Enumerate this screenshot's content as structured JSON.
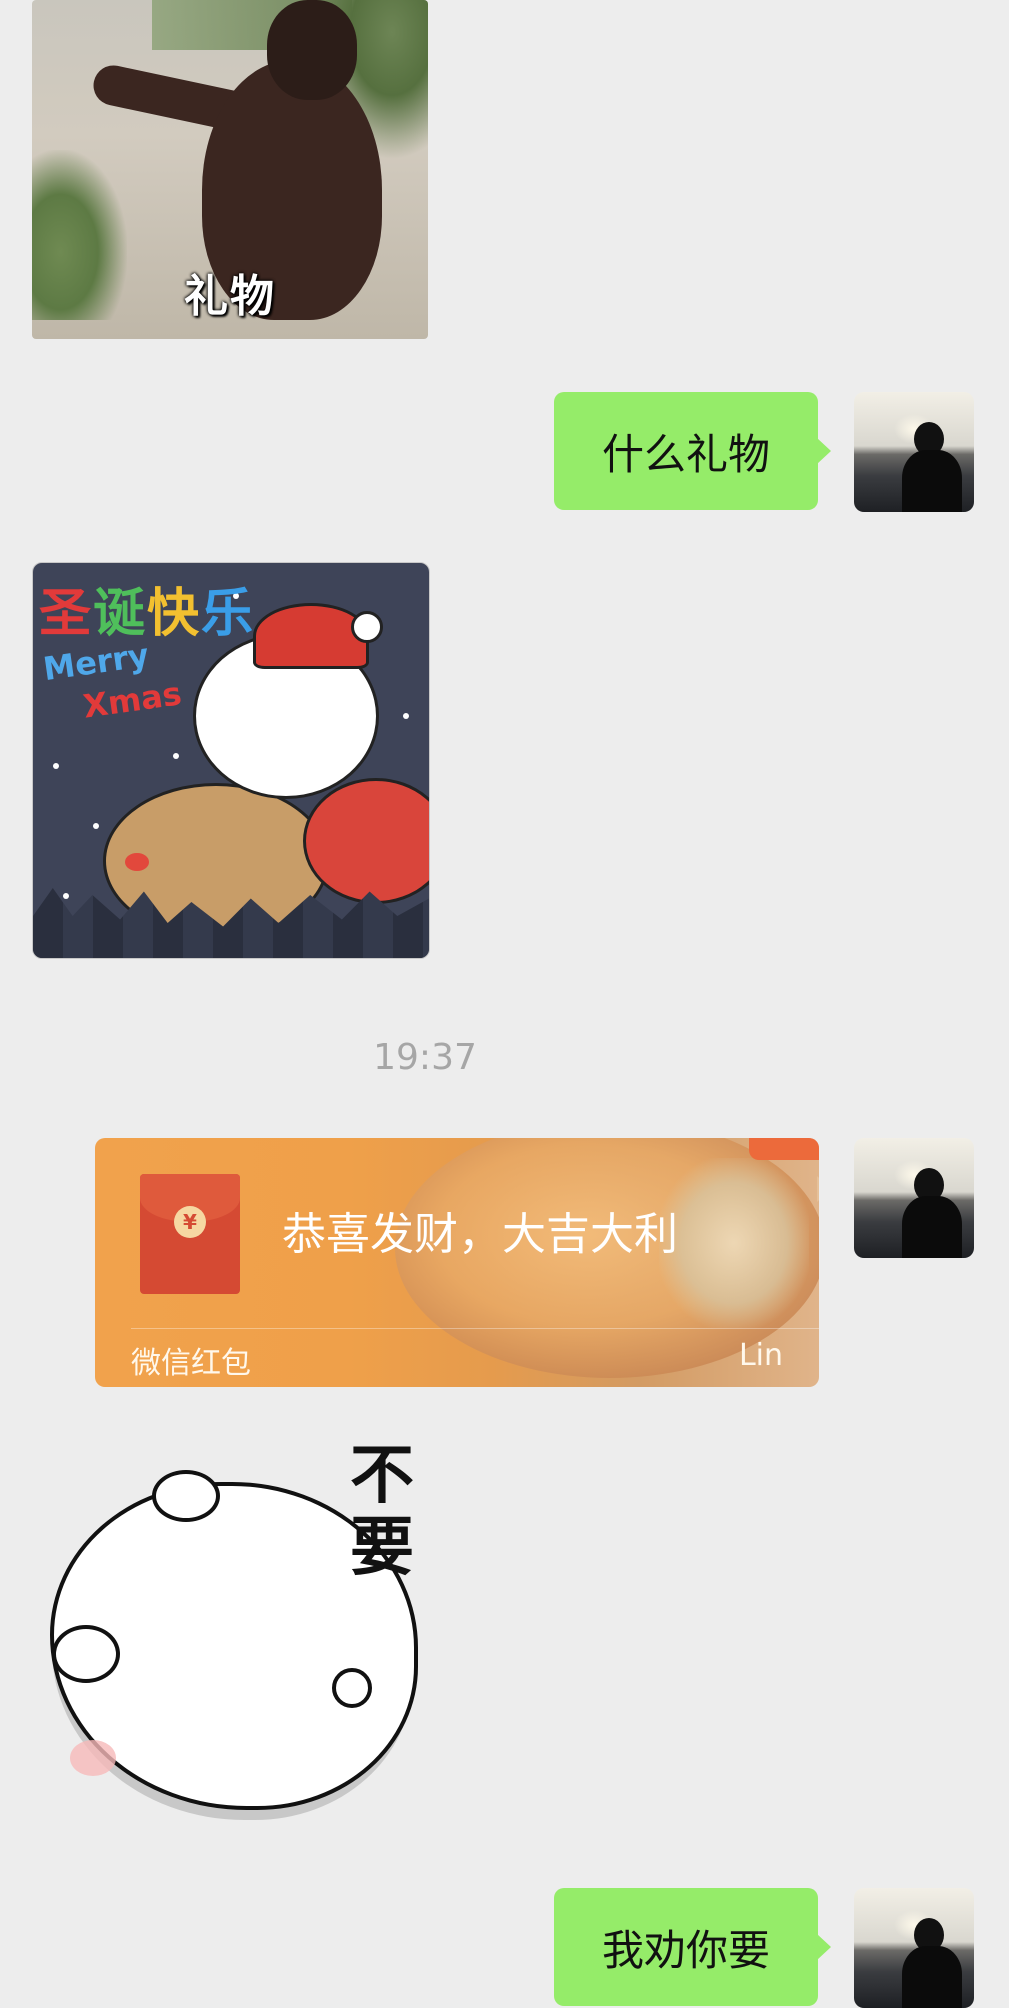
{
  "messages": {
    "sticker_orangutan": {
      "caption": "礼物"
    },
    "out_1": {
      "text": "什么礼物"
    },
    "sticker_christmas": {
      "title_chars": [
        "圣",
        "诞",
        "快",
        "乐"
      ],
      "line1": "Merry",
      "line2": "Xmas"
    },
    "timestamp": "19:37",
    "red_packet": {
      "wish": "恭喜发财，大吉大利",
      "label": "微信红包",
      "sender": "Lin",
      "coin_symbol": "¥"
    },
    "sticker_bear": {
      "text": "不要"
    },
    "out_2": {
      "text": "我劝你要"
    }
  },
  "colors": {
    "background": "#ededed",
    "bubble_green": "#95ec69",
    "packet_orange": "#f1a24c",
    "timestamp_gray": "#a6a6a6"
  }
}
